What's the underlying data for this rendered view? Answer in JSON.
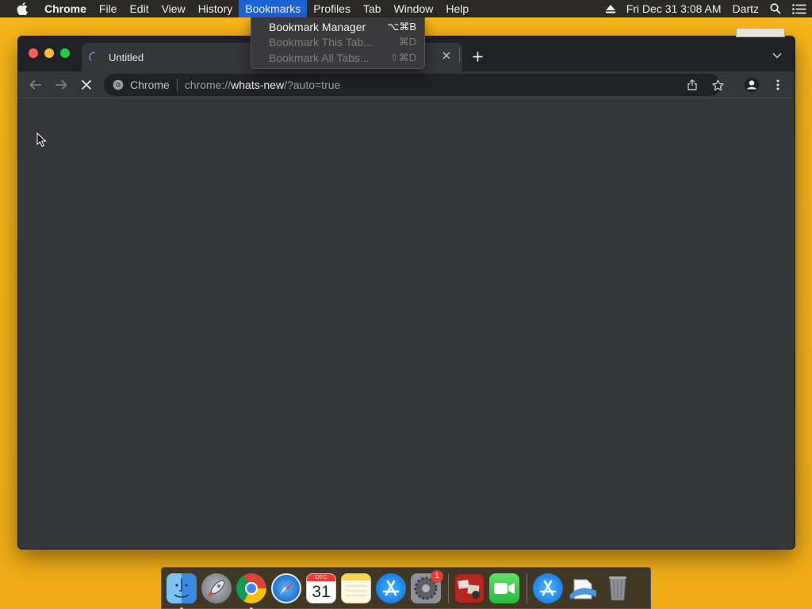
{
  "menubar": {
    "app_name": "Chrome",
    "menus": [
      "File",
      "Edit",
      "View",
      "History",
      "Bookmarks",
      "Profiles",
      "Tab",
      "Window",
      "Help"
    ],
    "active_menu": "Bookmarks",
    "datetime": "Fri Dec 31  3:08 AM",
    "user": "Dartz"
  },
  "bookmarks_menu": {
    "items": [
      {
        "label": "Bookmark Manager",
        "shortcut": "⌥⌘B",
        "enabled": true
      },
      {
        "label": "Bookmark This Tab...",
        "shortcut": "⌘D",
        "enabled": false
      },
      {
        "label": "Bookmark All Tabs...",
        "shortcut": "⇧⌘D",
        "enabled": false
      }
    ]
  },
  "browser": {
    "tab_title": "Untitled",
    "omnibox": {
      "chip": "Chrome",
      "url_scheme": "chrome://",
      "url_host": "whats-new",
      "url_rest": "/?auto=true"
    }
  },
  "dock": {
    "calendar_month": "DEC",
    "calendar_day": "31",
    "prefs_badge": "1"
  },
  "colors": {
    "desktop": "#f2b118",
    "menu_highlight": "#1e63d6",
    "chrome_dark": "#35363a",
    "tabstrip": "#202124"
  }
}
